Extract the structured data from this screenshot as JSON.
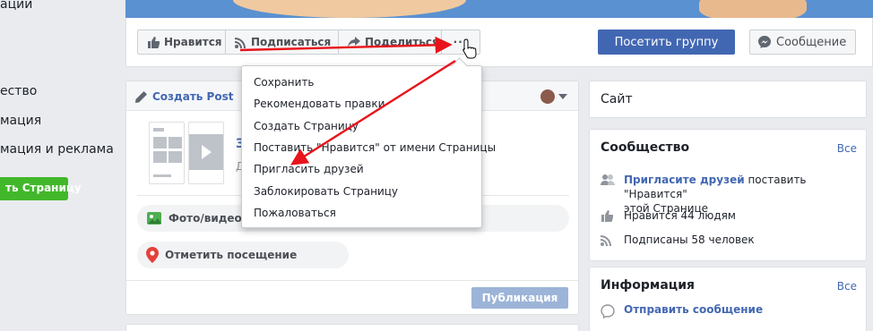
{
  "left_nav": {
    "items": [
      "ации",
      "ество",
      "мация",
      "мация и реклама"
    ],
    "create_page": "ть Страницу"
  },
  "action_bar": {
    "like": "Нравится",
    "follow": "Подписаться",
    "share": "Поделиться",
    "more": "···",
    "visit_group": "Посетить группу",
    "message": "Сообщение"
  },
  "composer": {
    "create_post": "Создать Post",
    "partial_title": "З",
    "partial_sub": "Д",
    "photo_video": "Фото/видео",
    "check_in": "Отметить посещение",
    "publish": "Публикация"
  },
  "dropdown": {
    "items": [
      "Сохранить",
      "Рекомендовать правки",
      "Создать Страницу",
      "Поставить \"Нравится\" от имени Страницы",
      "Пригласить друзей",
      "Заблокировать Страницу",
      "Пожаловаться"
    ]
  },
  "right": {
    "site": "Сайт",
    "community": {
      "title": "Сообщество",
      "see_all": "Все",
      "invite_link": "Пригласите друзей",
      "invite_rest": " поставить \"Нравится\"",
      "invite_line2": "этой Странице",
      "likes": "Нравится 44 людям",
      "followers": "Подписаны 58 человек"
    },
    "info": {
      "title": "Информация",
      "see_all": "Все",
      "send_message": "Отправить сообщение"
    }
  },
  "colors": {
    "brand_blue": "#4267b2",
    "green": "#42b72a",
    "annotation_red": "#e8141b"
  }
}
